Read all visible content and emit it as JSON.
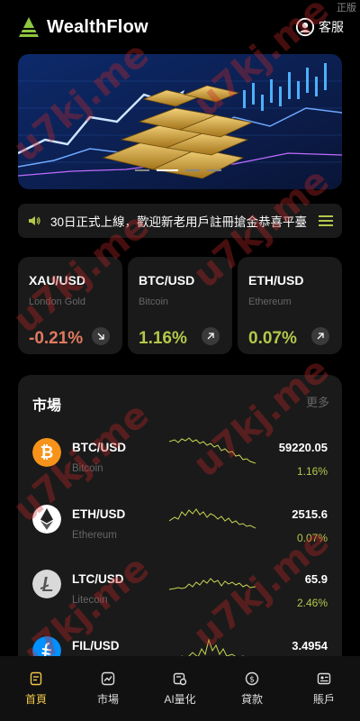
{
  "corner_tag": "正版",
  "header": {
    "brand": "WealthFlow",
    "service_label": "客服"
  },
  "notice": {
    "text": "30日正式上線，歡迎新老用戶註冊搶金恭喜平臺"
  },
  "tickers": [
    {
      "pair": "XAU/USD",
      "name": "London Gold",
      "change": "-0.21%",
      "direction": "down"
    },
    {
      "pair": "BTC/USD",
      "name": "Bitcoin",
      "change": "1.16%",
      "direction": "up"
    },
    {
      "pair": "ETH/USD",
      "name": "Ethereum",
      "change": "0.07%",
      "direction": "up"
    }
  ],
  "market": {
    "title": "市場",
    "more": "更多",
    "rows": [
      {
        "symbol": "BTC/USD",
        "name": "Bitcoin",
        "price": "59220.05",
        "change": "1.16%",
        "icon": "bitcoin-icon",
        "color": "#f7931a"
      },
      {
        "symbol": "ETH/USD",
        "name": "Ethereum",
        "price": "2515.6",
        "change": "0.07%",
        "icon": "ethereum-icon",
        "color": "#ffffff"
      },
      {
        "symbol": "LTC/USD",
        "name": "Litecoin",
        "price": "65.9",
        "change": "2.46%",
        "icon": "litecoin-icon",
        "color": "#d9d9d9"
      },
      {
        "symbol": "FIL/USD",
        "name": "",
        "price": "3.4954",
        "change": "",
        "icon": "filecoin-icon",
        "color": "#0090ff"
      }
    ]
  },
  "nav": [
    {
      "label": "首頁",
      "icon": "home-icon",
      "active": true
    },
    {
      "label": "市場",
      "icon": "market-icon",
      "active": false
    },
    {
      "label": "AI量化",
      "icon": "ai-quant-icon",
      "active": false
    },
    {
      "label": "貸款",
      "icon": "loan-icon",
      "active": false
    },
    {
      "label": "賬戶",
      "icon": "account-icon",
      "active": false
    }
  ],
  "watermark": "u7kj.me",
  "colors": {
    "accent": "#f2c84b",
    "positive": "#b5c74a",
    "negative": "#e07a5f",
    "card": "#1a1a1a"
  }
}
